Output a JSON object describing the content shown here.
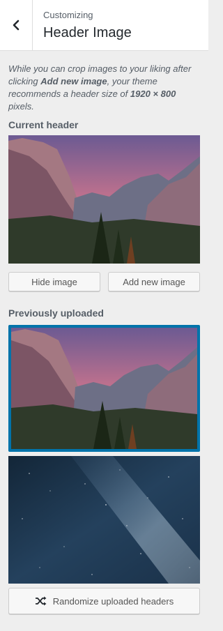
{
  "header": {
    "breadcrumb": "Customizing",
    "title": "Header Image"
  },
  "description": {
    "part1": "While you can crop images to your liking after clicking ",
    "bold1": "Add new image",
    "part2": ", your theme recommends a header size of ",
    "bold2": "1920 × 800",
    "part3": " pixels."
  },
  "current_header": {
    "label": "Current header",
    "hide_button": "Hide image",
    "add_button": "Add new image"
  },
  "previously_uploaded": {
    "label": "Previously uploaded",
    "randomize_button": "Randomize uploaded headers"
  },
  "colors": {
    "accent": "#0073aa",
    "background": "#eeeeee"
  }
}
